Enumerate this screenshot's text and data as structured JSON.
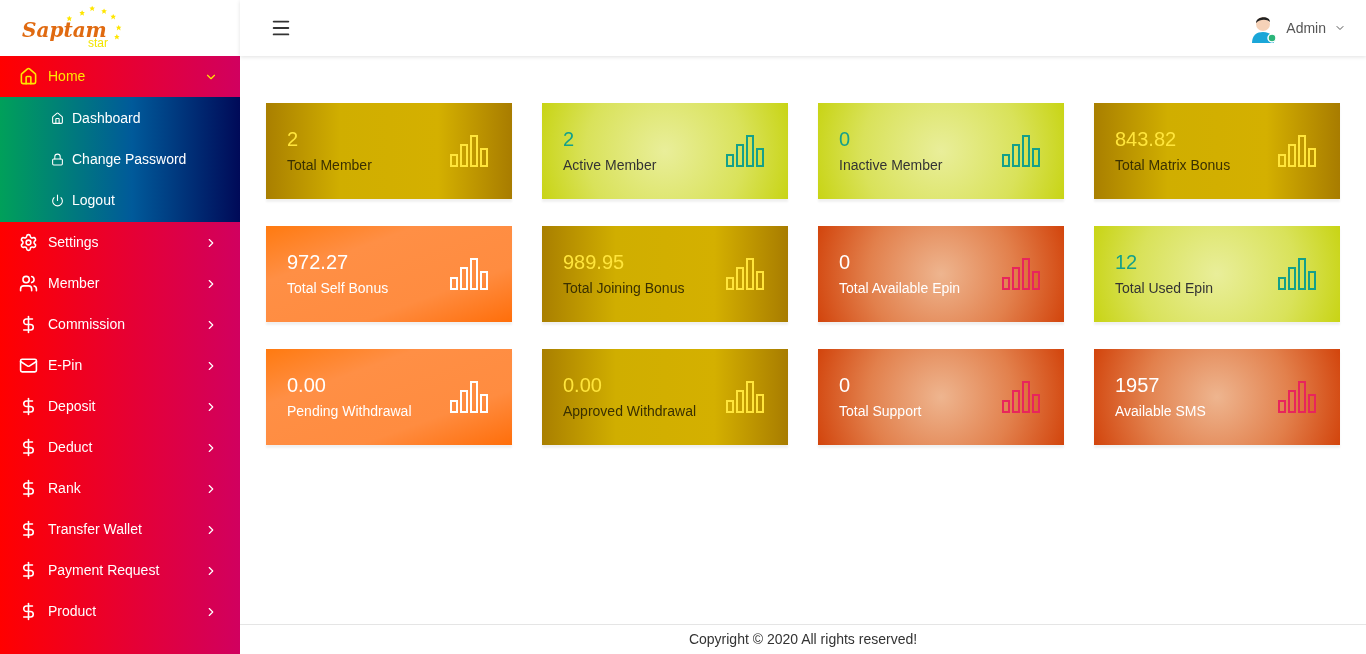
{
  "logo": {
    "name": "Saptam",
    "tagline": "star"
  },
  "user": {
    "name": "Admin"
  },
  "sidebar": {
    "items": [
      {
        "label": "Home",
        "kind": "home",
        "expanded": true,
        "selected": true,
        "children": [
          {
            "label": "Dashboard",
            "kind": "home"
          },
          {
            "label": "Change Password",
            "kind": "lock"
          },
          {
            "label": "Logout",
            "kind": "power"
          }
        ]
      },
      {
        "label": "Settings",
        "kind": "settings",
        "expanded": false,
        "selected": false
      },
      {
        "label": "Member",
        "kind": "member",
        "expanded": false,
        "selected": false
      },
      {
        "label": "Commission",
        "kind": "dollar",
        "expanded": false,
        "selected": false
      },
      {
        "label": "E-Pin",
        "kind": "mail",
        "expanded": false,
        "selected": false
      },
      {
        "label": "Deposit",
        "kind": "dollar",
        "expanded": false,
        "selected": false
      },
      {
        "label": "Deduct",
        "kind": "dollar",
        "expanded": false,
        "selected": false
      },
      {
        "label": "Rank",
        "kind": "dollar",
        "expanded": false,
        "selected": false
      },
      {
        "label": "Transfer Wallet",
        "kind": "dollar",
        "expanded": false,
        "selected": false
      },
      {
        "label": "Payment Request",
        "kind": "dollar",
        "expanded": false,
        "selected": false
      },
      {
        "label": "Product",
        "kind": "dollar",
        "expanded": false,
        "selected": false
      }
    ]
  },
  "cards": [
    {
      "value": "2",
      "label": "Total Member",
      "kind": "gold"
    },
    {
      "value": "2",
      "label": "Active Member",
      "kind": "lime"
    },
    {
      "value": "0",
      "label": "Inactive Member",
      "kind": "lime"
    },
    {
      "value": "843.82",
      "label": "Total Matrix Bonus",
      "kind": "gold"
    },
    {
      "value": "972.27",
      "label": "Total Self Bonus",
      "kind": "orange"
    },
    {
      "value": "989.95",
      "label": "Total Joining Bonus",
      "kind": "gold"
    },
    {
      "value": "0",
      "label": "Total Available Epin",
      "kind": "red"
    },
    {
      "value": "12",
      "label": "Total Used Epin",
      "kind": "lime"
    },
    {
      "value": "0.00",
      "label": "Pending Withdrawal",
      "kind": "orange"
    },
    {
      "value": "0.00",
      "label": "Approved Withdrawal",
      "kind": "gold"
    },
    {
      "value": "0",
      "label": "Total Support",
      "kind": "red"
    },
    {
      "value": "1957",
      "label": "Available SMS",
      "kind": "red"
    }
  ],
  "footer": {
    "text": "Copyright © 2020 All rights reserved!"
  }
}
